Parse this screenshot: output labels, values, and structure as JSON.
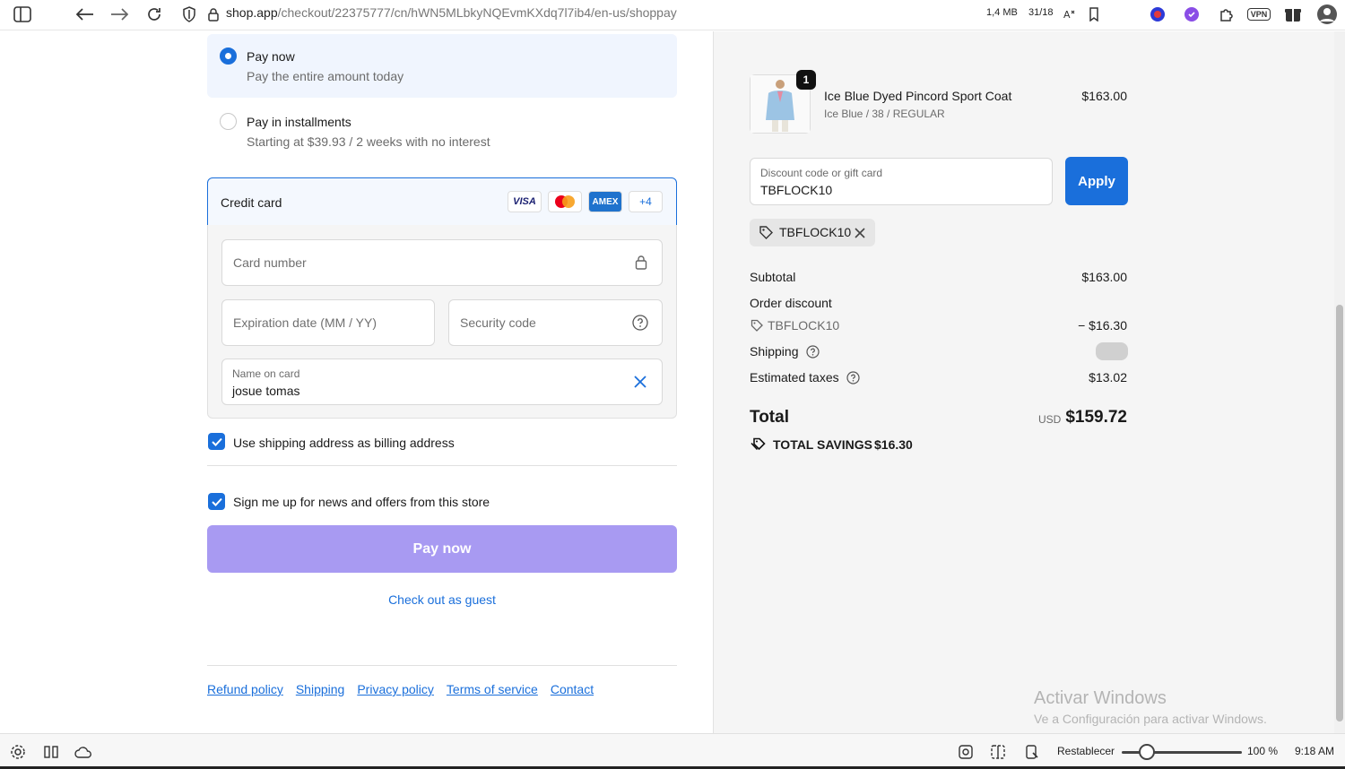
{
  "browser": {
    "url_host": "shop.app",
    "url_path": "/checkout/22375777/cn/hWN5MLbkyNQEvmKXdq7l7ib4/en-us/shoppay",
    "memory": "1,4 MB",
    "tabs_counter": "31/18",
    "vpn_label": "VPN"
  },
  "payment_options": {
    "pay_now_title": "Pay now",
    "pay_now_sub": "Pay the entire amount today",
    "installments_title": "Pay in installments",
    "installments_sub": "Starting at $39.93 / 2 weeks with no interest"
  },
  "credit_card": {
    "title": "Credit card",
    "badges": {
      "visa": "VISA",
      "amex": "AMEX",
      "more": "+4"
    },
    "card_number_placeholder": "Card number",
    "expiration_placeholder": "Expiration date (MM / YY)",
    "security_placeholder": "Security code",
    "name_label": "Name on card",
    "name_value": "josue tomas"
  },
  "checkboxes": {
    "billing_label": "Use shipping address as billing address",
    "newsletter_label": "Sign me up for news and offers from this store"
  },
  "actions": {
    "pay_now_button": "Pay now",
    "guest_link": "Check out as guest"
  },
  "footer_links": [
    "Refund policy",
    "Shipping",
    "Privacy policy",
    "Terms of service",
    "Contact"
  ],
  "order": {
    "quantity": "1",
    "product_name": "Ice Blue Dyed Pincord Sport Coat",
    "product_variant": "Ice Blue / 38 / REGULAR",
    "product_price": "$163.00",
    "discount_label": "Discount code or gift card",
    "discount_value": "TBFLOCK10",
    "apply_button": "Apply",
    "applied_code": "TBFLOCK10",
    "subtotal_label": "Subtotal",
    "subtotal_value": "$163.00",
    "order_discount_label": "Order discount",
    "discount_code_line": "TBFLOCK10",
    "discount_amount": "− $16.30",
    "shipping_label": "Shipping",
    "taxes_label": "Estimated taxes",
    "taxes_value": "$13.02",
    "total_label": "Total",
    "currency": "USD",
    "total_value": "$159.72",
    "savings_label": "TOTAL SAVINGS",
    "savings_value": "$16.30"
  },
  "watermark": {
    "line1": "Activar Windows",
    "line2": "Ve a Configuración para activar Windows."
  },
  "statusbar": {
    "reset_label": "Restablecer",
    "zoom": "100 %",
    "time": "9:18 AM"
  },
  "colors": {
    "accent": "#1a6fdb",
    "pay_button": "#a89af2",
    "summary_bg": "#f5f5f5"
  }
}
